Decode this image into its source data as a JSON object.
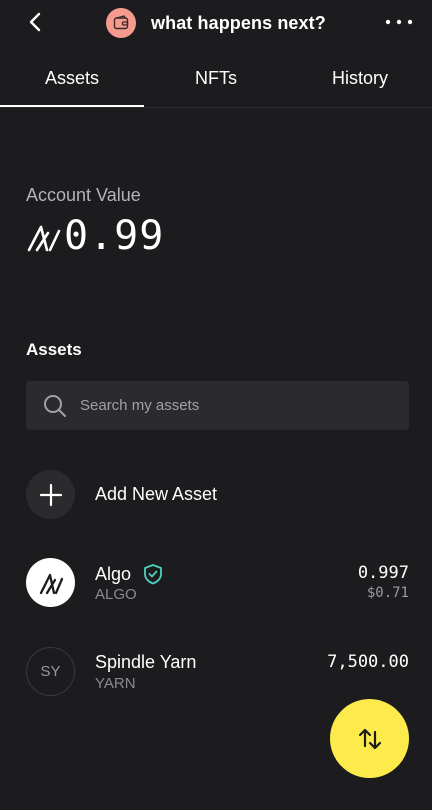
{
  "header": {
    "title": "what happens next?",
    "back_icon": "chevron-left-icon",
    "wallet_icon": "wallet-icon",
    "wallet_badge_color": "#f59b8d",
    "more_icon": "more-horizontal-icon"
  },
  "tabs": [
    {
      "label": "Assets",
      "active": true
    },
    {
      "label": "NFTs",
      "active": false
    },
    {
      "label": "History",
      "active": false
    }
  ],
  "account": {
    "label": "Account Value",
    "currency_icon": "algo-icon",
    "value": "0.99"
  },
  "assets_section": {
    "title": "Assets",
    "search_placeholder": "Search my assets",
    "search_icon": "search-icon",
    "add_label": "Add New Asset",
    "add_icon": "plus-icon",
    "items": [
      {
        "name": "Algo",
        "ticker": "ALGO",
        "amount": "0.997",
        "fiat": "$0.71",
        "verified": true,
        "icon": "algo-icon",
        "verified_color": "#4cd0c0"
      },
      {
        "name": "Spindle Yarn",
        "ticker": "YARN",
        "amount": "7,500.00",
        "fiat": "",
        "verified": false,
        "icon_text": "SY"
      }
    ]
  },
  "fab": {
    "icon": "swap-vertical-icon",
    "color": "#fdeb4b"
  }
}
